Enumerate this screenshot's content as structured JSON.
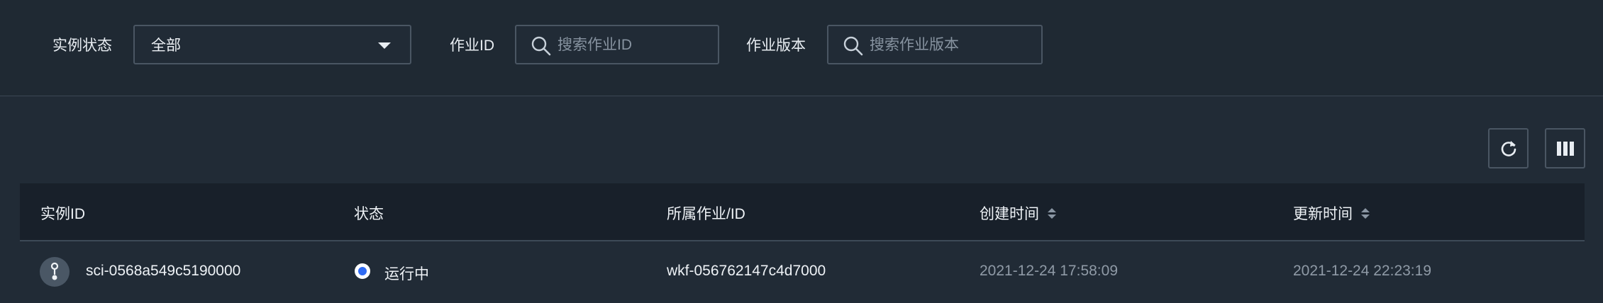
{
  "filters": {
    "status_label": "实例状态",
    "status_value": "全部",
    "job_id_label": "作业ID",
    "job_id_placeholder": "搜索作业ID",
    "job_version_label": "作业版本",
    "job_version_placeholder": "搜索作业版本"
  },
  "toolbar": {
    "refresh_icon": "refresh-icon",
    "columns_icon": "columns-icon"
  },
  "table": {
    "columns": [
      "实例ID",
      "状态",
      "所属作业/ID",
      "创建时间",
      "更新时间"
    ],
    "rows": [
      {
        "instance_id": "sci-0568a549c5190000",
        "status": "运行中",
        "job_id": "wkf-056762147c4d7000",
        "created": "2021-12-24 17:58:09",
        "updated": "2021-12-24 22:23:19"
      }
    ]
  },
  "colors": {
    "background": "#212b36",
    "header": "#18202a",
    "running": "#2f6bf3"
  }
}
